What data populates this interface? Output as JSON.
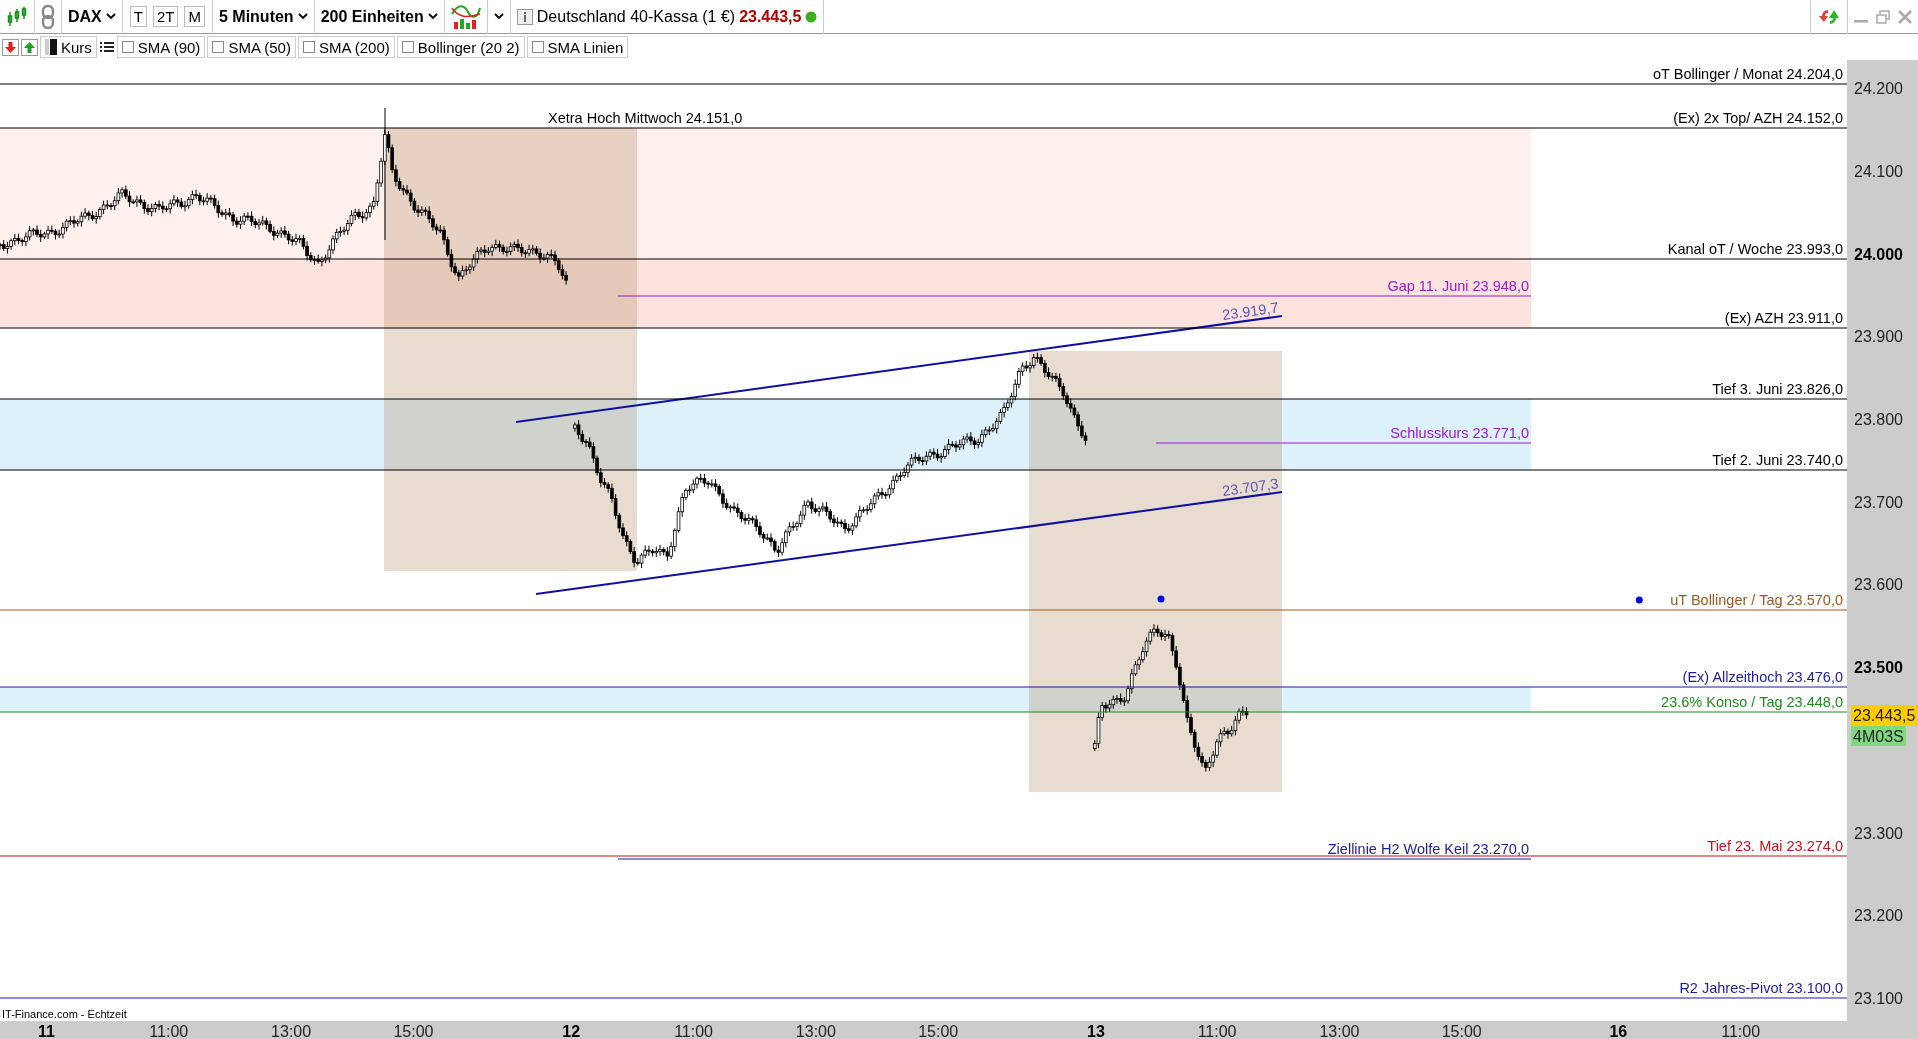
{
  "toolbar": {
    "symbol": "DAX",
    "period_buttons": [
      {
        "label": "T"
      },
      {
        "label": "2T"
      },
      {
        "label": "M"
      }
    ],
    "interval": "5 Minuten",
    "units": "200 Einheiten",
    "instrument": "Deutschland 40-Kassa (1 €)",
    "last_price": "23.443,5",
    "online": true
  },
  "indicator_bar": {
    "price_type": "Kurs",
    "indicators": [
      {
        "label": "SMA (90)",
        "checked": false
      },
      {
        "label": "SMA (50)",
        "checked": false
      },
      {
        "label": "SMA (200)",
        "checked": false
      },
      {
        "label": "Bollinger (20 2)",
        "checked": false
      },
      {
        "label": "SMA Linien",
        "checked": false
      }
    ]
  },
  "chart": {
    "levels": [
      {
        "label": "oT Bollinger / Monat 24.204,0",
        "color": "#000000",
        "dot": false
      },
      {
        "label": "(Ex) 2x Top/ AZH 24.152,0",
        "color": "#000000",
        "dot": false
      },
      {
        "label": "Kanal oT / Woche 23.993,0",
        "color": "#000000",
        "dot": false
      },
      {
        "label": "(Ex)  AZH 23.911,0",
        "color": "#000000",
        "dot": false
      },
      {
        "label": "Tief 3. Juni 23.826,0",
        "color": "#000000",
        "dot": false
      },
      {
        "label": "Tief 2. Juni 23.740,0",
        "color": "#000000",
        "dot": false
      },
      {
        "label": "uT Bollinger / Tag 23.570,0",
        "color": "#9a5a1e",
        "dot": true
      },
      {
        "label": "(Ex)  Allzeithoch  23.476,0",
        "color": "#1c1ca0",
        "dot": false
      },
      {
        "label": "23.6% Konso / Tag 23.448,0",
        "color": "#1e8c1e",
        "dot": false
      },
      {
        "label": "Tief 23. Mai  23.274,0",
        "color": "#c0141c",
        "dot": false
      },
      {
        "label": "R2 Jahres-Pivot  23.100,0",
        "color": "#1c1ca0",
        "dot": false
      }
    ],
    "short_levels": [
      {
        "label": "Gap 11. Juni 23.948,0",
        "color": "#9a1ad0"
      },
      {
        "label": "Schlusskurs 23.771,0",
        "color": "#9a1ad0"
      },
      {
        "label": "Ziellinie H2 Wolfe Keil 23.270,0",
        "color": "#1c1ca0"
      }
    ],
    "annotation": "Xetra Hoch Mittwoch 24.151,0",
    "trendline_labels": [
      "23.919,7",
      "23.707,3"
    ],
    "price_ticks": [
      {
        "label": "24.200",
        "kind": "minor"
      },
      {
        "label": "24.100",
        "kind": "minor"
      },
      {
        "label": "24.000",
        "kind": "major"
      },
      {
        "label": "23.900",
        "kind": "minor"
      },
      {
        "label": "23.800",
        "kind": "minor"
      },
      {
        "label": "23.700",
        "kind": "minor"
      },
      {
        "label": "23.600",
        "kind": "minor"
      },
      {
        "label": "23.500",
        "kind": "major"
      },
      {
        "label": "23.300",
        "kind": "minor"
      },
      {
        "label": "23.200",
        "kind": "minor"
      },
      {
        "label": "23.100",
        "kind": "minor"
      }
    ],
    "current_price": "23.443,5",
    "countdown": "4M03S",
    "time_labels": [
      {
        "label": "11",
        "kind": "day"
      },
      {
        "label": "11:00",
        "kind": "time"
      },
      {
        "label": "13:00",
        "kind": "time"
      },
      {
        "label": "15:00",
        "kind": "time"
      },
      {
        "label": "12",
        "kind": "day"
      },
      {
        "label": "11:00",
        "kind": "time"
      },
      {
        "label": "13:00",
        "kind": "time"
      },
      {
        "label": "15:00",
        "kind": "time"
      },
      {
        "label": "13",
        "kind": "day"
      },
      {
        "label": "11:00",
        "kind": "time"
      },
      {
        "label": "13:00",
        "kind": "time"
      },
      {
        "label": "15:00",
        "kind": "time"
      },
      {
        "label": "16",
        "kind": "day"
      },
      {
        "label": "11:00",
        "kind": "time"
      }
    ],
    "source": "IT-Finance.com - Echtzeit"
  }
}
